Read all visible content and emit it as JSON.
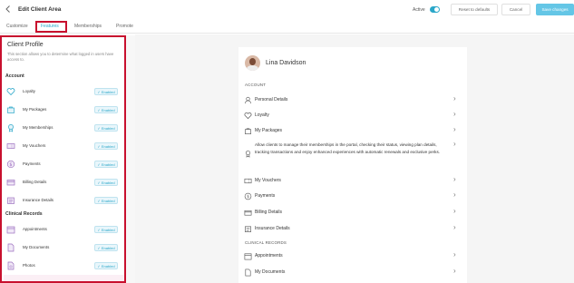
{
  "header": {
    "back_icon": "chevron-left-icon",
    "title": "Edit Client Area",
    "active_label": "Active",
    "reset_label": "Reset to defaults",
    "cancel_label": "Cancel",
    "save_label": "Save changes",
    "accent_color": "#2aa7c9"
  },
  "tabs": [
    {
      "label": "Customize"
    },
    {
      "label": "Features"
    },
    {
      "label": "Memberships"
    },
    {
      "label": "Promote"
    }
  ],
  "left_panel": {
    "title": "Client Profile",
    "description": "This section allows you to determine what logged in users have access to.",
    "sections": [
      {
        "heading": "Account",
        "items": [
          {
            "label": "Loyalty",
            "badge": "✓ Enabled",
            "icon": "heart-icon"
          },
          {
            "label": "My Packages",
            "badge": "✓ Enabled",
            "icon": "bag-icon"
          },
          {
            "label": "My Memberships",
            "badge": "✓ Enabled",
            "icon": "badge-icon"
          },
          {
            "label": "My Vouchers",
            "badge": "✓ Enabled",
            "icon": "voucher-icon"
          },
          {
            "label": "Payments",
            "badge": "✓ Enabled",
            "icon": "dollar-icon"
          },
          {
            "label": "Billing Details",
            "badge": "✓ Enabled",
            "icon": "card-icon"
          },
          {
            "label": "Insurance Details",
            "badge": "✓ Enabled",
            "icon": "insurance-icon"
          }
        ]
      },
      {
        "heading": "Clinical Records",
        "items": [
          {
            "label": "Appointments",
            "badge": "✓ Enabled",
            "icon": "calendar-icon"
          },
          {
            "label": "My Documents",
            "badge": "✓ Enabled",
            "icon": "document-icon"
          },
          {
            "label": "Photos",
            "badge": "✓ Enabled",
            "icon": "photo-icon"
          }
        ]
      }
    ]
  },
  "preview": {
    "user_name": "Lina Davidson",
    "account_heading": "ACCOUNT",
    "account_items": [
      {
        "label": "Personal Details",
        "icon": "person-icon"
      },
      {
        "label": "Loyalty",
        "icon": "heart-icon"
      },
      {
        "label": "My Packages",
        "icon": "bag-icon"
      }
    ],
    "membership_text": "Allow clients to manage their memberships in the portal, checking their status, viewing plan details, tracking transactions and enjoy enhanced experiences with automatic renewals and exclusive perks.",
    "account_items_2": [
      {
        "label": "My Vouchers",
        "icon": "voucher-icon"
      },
      {
        "label": "Payments",
        "icon": "dollar-icon"
      },
      {
        "label": "Billing Details",
        "icon": "card-icon"
      },
      {
        "label": "Insurance Details",
        "icon": "insurance-icon"
      }
    ],
    "clinical_heading": "CLINICAL RECORDS",
    "clinical_items": [
      {
        "label": "Appointments",
        "icon": "calendar-icon"
      },
      {
        "label": "My Documents",
        "icon": "document-icon"
      }
    ],
    "chevron": "›"
  }
}
